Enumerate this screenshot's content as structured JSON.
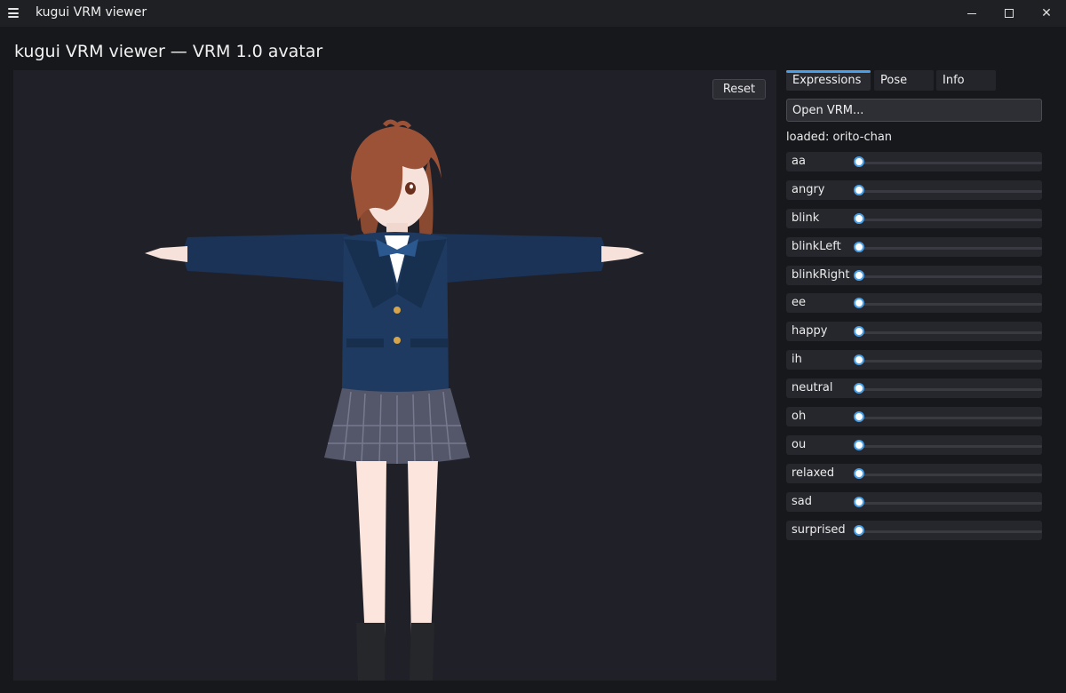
{
  "window": {
    "title": "kugui VRM viewer",
    "menu_icon": "hamburger-menu-icon",
    "controls": [
      "minimize-icon",
      "maximize-icon",
      "close-icon"
    ],
    "close_glyph": "✕"
  },
  "heading": "kugui VRM viewer — VRM 1.0 avatar",
  "viewport": {
    "reset_label": "Reset",
    "background": "#202029"
  },
  "panel": {
    "tabs": [
      {
        "label": "Expressions",
        "active": true
      },
      {
        "label": "Pose",
        "active": false
      },
      {
        "label": "Info",
        "active": false
      }
    ],
    "open_label": "Open VRM...",
    "loaded_text": "loaded: orito-chan",
    "expressions": [
      {
        "label": "aa",
        "value": 0
      },
      {
        "label": "angry",
        "value": 0
      },
      {
        "label": "blink",
        "value": 0
      },
      {
        "label": "blinkLeft",
        "value": 0
      },
      {
        "label": "blinkRight",
        "value": 0
      },
      {
        "label": "ee",
        "value": 0
      },
      {
        "label": "happy",
        "value": 0
      },
      {
        "label": "ih",
        "value": 0
      },
      {
        "label": "neutral",
        "value": 0
      },
      {
        "label": "oh",
        "value": 0
      },
      {
        "label": "ou",
        "value": 0
      },
      {
        "label": "relaxed",
        "value": 0
      },
      {
        "label": "sad",
        "value": 0
      },
      {
        "label": "surprised",
        "value": 0
      }
    ]
  },
  "colors": {
    "accent": "#4a9fe8",
    "app_background": "#17181c",
    "titlebar": "#1f2023"
  }
}
